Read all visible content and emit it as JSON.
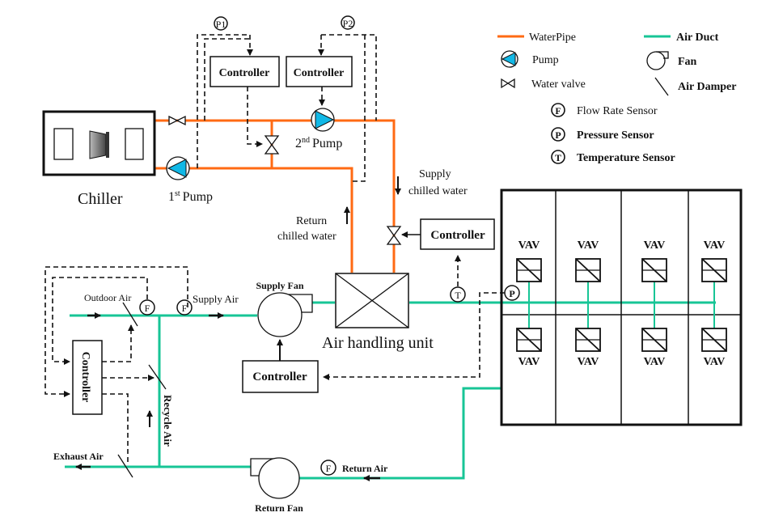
{
  "legend": {
    "water_pipe": "WaterPipe",
    "air_duct": "Air Duct",
    "pump": "Pump",
    "fan": "Fan",
    "water_valve": "Water valve",
    "air_damper": "Air Damper",
    "flow_rate_sensor": "Flow Rate Sensor",
    "pressure_sensor": "Pressure Sensor",
    "temperature_sensor": "Temperature Sensor",
    "sensor_F": "F",
    "sensor_P": "P",
    "sensor_T": "T"
  },
  "colors": {
    "water_pipe": "#ff6a13",
    "air_duct": "#17c596",
    "pump_fill": "#11b8e6"
  },
  "water_loop": {
    "chiller": "Chiller",
    "pump1_main": "1",
    "pump1_sup": "st",
    "pump1_word": "Pump",
    "pump2_main": "2",
    "pump2_sup": "nd",
    "pump2_word": "Pump",
    "p1": "P1",
    "p2": "P2",
    "controller1": "Controller",
    "controller2": "Controller",
    "supply_line1": "Supply",
    "supply_line2": "chilled water",
    "return_line1": "Return",
    "return_line2": "chilled water",
    "valve_controller": "Controller"
  },
  "air_loop": {
    "outdoor_air": "Outdoor Air",
    "supply_air": "Supply Air",
    "supply_fan": "Supply Fan",
    "ahu": "Air handling unit",
    "fan_controller": "Controller",
    "damper_controller": "Controller",
    "recycle_air": "Recycle Air",
    "exhaust_air": "Exhaust Air",
    "return_air": "Return Air",
    "return_fan": "Return Fan",
    "sensor_T": "T",
    "sensor_P": "P",
    "sensor_F": "F"
  },
  "vav": {
    "label": "VAV",
    "top": [
      "VAV",
      "VAV",
      "VAV",
      "VAV"
    ],
    "bottom": [
      "VAV",
      "VAV",
      "VAV",
      "VAV"
    ]
  }
}
